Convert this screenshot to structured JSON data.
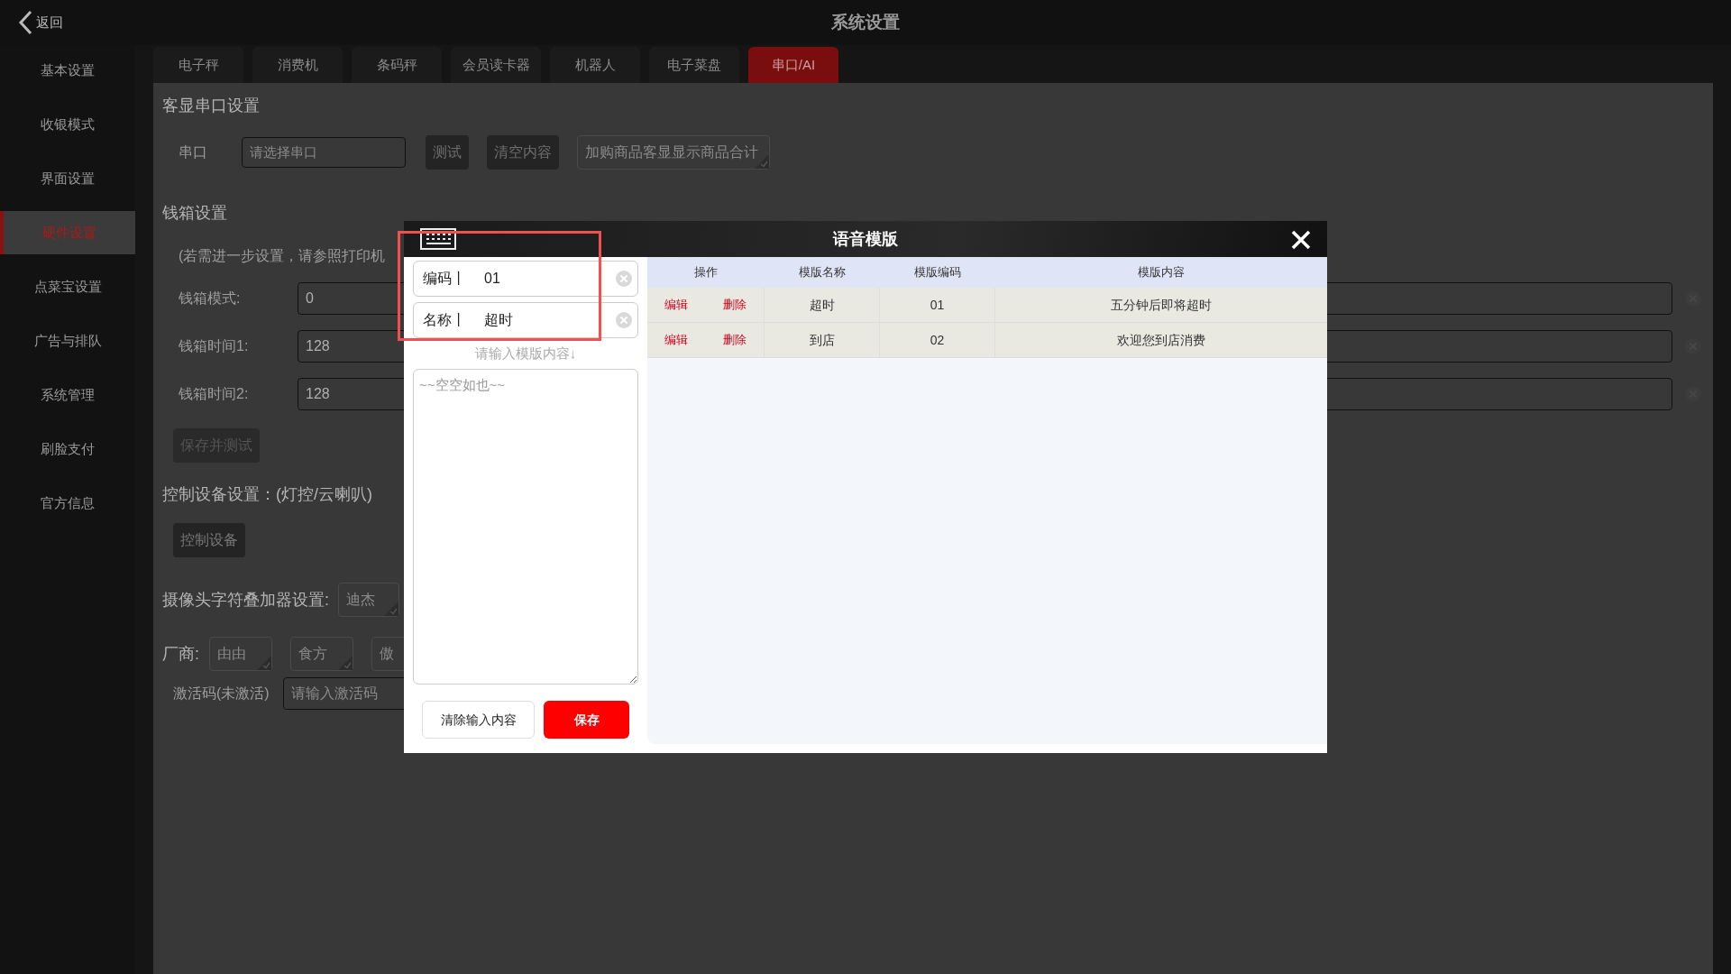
{
  "top_bar": {
    "back": "返回",
    "title": "系统设置"
  },
  "sidebar": {
    "items": [
      {
        "label": "基本设置",
        "selected": false
      },
      {
        "label": "收银模式",
        "selected": false
      },
      {
        "label": "界面设置",
        "selected": false
      },
      {
        "label": "硬件设置",
        "selected": true
      },
      {
        "label": "点菜宝设置",
        "selected": false
      },
      {
        "label": "广告与排队",
        "selected": false
      },
      {
        "label": "系统管理",
        "selected": false
      },
      {
        "label": "刷脸支付",
        "selected": false
      },
      {
        "label": "官方信息",
        "selected": false
      }
    ]
  },
  "tabs": [
    {
      "label": "电子秤",
      "selected": false
    },
    {
      "label": "消费机",
      "selected": false
    },
    {
      "label": "条码秤",
      "selected": false
    },
    {
      "label": "会员读卡器",
      "selected": false
    },
    {
      "label": "机器人",
      "selected": false
    },
    {
      "label": "电子菜盘",
      "selected": false
    },
    {
      "label": "串口/AI",
      "selected": true
    }
  ],
  "serial_display": {
    "heading": "客显串口设置",
    "port_label": "串口",
    "port_placeholder": "请选择串口",
    "buttons": [
      "测试",
      "清空内容"
    ],
    "option": "加购商品客显显示商品合计"
  },
  "cash_drawer": {
    "heading": "钱箱设置",
    "note": "(若需进一步设置，请参照打印机",
    "rows": [
      {
        "label": "钱箱模式:",
        "value": "0"
      },
      {
        "label": "钱箱时间1:",
        "value": "128"
      },
      {
        "label": "钱箱时间2:",
        "value": "128"
      }
    ],
    "button": "保存并测试"
  },
  "control": {
    "heading": "控制设备设置：(灯控/云喇叭)",
    "button": "控制设备"
  },
  "camera": {
    "label": "摄像头字符叠加器设置:",
    "option": "迪杰"
  },
  "vendor": {
    "label": "厂商:",
    "options": [
      "由由",
      "食方",
      "傲"
    ]
  },
  "activation": {
    "label": "激活码(未激活)",
    "placeholder": "请输入激活码"
  },
  "dialog": {
    "title": "语音模版",
    "fields": [
      {
        "label": "编码丨",
        "value": "01"
      },
      {
        "label": "名称丨",
        "value": "超时"
      }
    ],
    "content_hint": "请输入模版内容↓",
    "content_placeholder": "~~空空如也~~",
    "clear_button": "清除输入内容",
    "save_button": "保存",
    "table": {
      "columns": [
        "操作",
        "模版名称",
        "模版编码",
        "模版内容"
      ],
      "rows": [
        {
          "actions": [
            "编辑",
            "删除"
          ],
          "name": "超时",
          "code": "01",
          "content": "五分钟后即将超时"
        },
        {
          "actions": [
            "编辑",
            "删除"
          ],
          "name": "到店",
          "code": "02",
          "content": "欢迎您到店消费"
        }
      ]
    }
  }
}
